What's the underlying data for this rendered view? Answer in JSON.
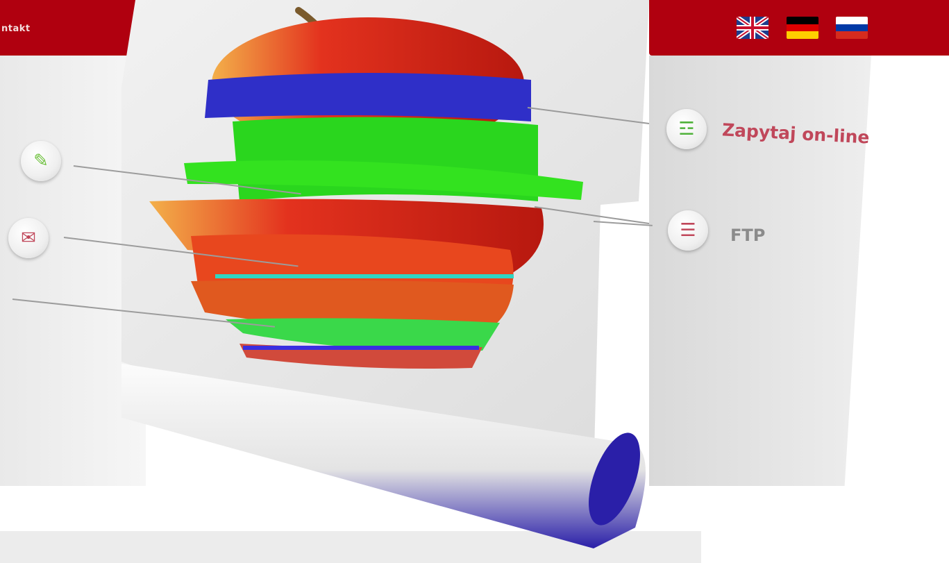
{
  "header": {
    "contact_label": "ntakt"
  },
  "languages": [
    {
      "icon": "flag-uk-icon",
      "colors": [
        "#1f3d8c",
        "#ffffff",
        "#c8102e"
      ]
    },
    {
      "icon": "flag-de-icon",
      "colors": [
        "#000000",
        "#dd0000",
        "#ffce00"
      ]
    },
    {
      "icon": "flag-ru-icon",
      "colors": [
        "#ffffff",
        "#0039a6",
        "#d52b1e"
      ]
    }
  ],
  "left_icons": [
    {
      "icon": "pencil-icon"
    },
    {
      "icon": "mail-icon"
    }
  ],
  "right_links": [
    {
      "icon": "chat-icon",
      "label": "Zapytaj on-line"
    },
    {
      "icon": "ftp-icon",
      "label": "FTP"
    }
  ],
  "theme": {
    "accent": "#b0000f",
    "link": "#c0475a"
  }
}
